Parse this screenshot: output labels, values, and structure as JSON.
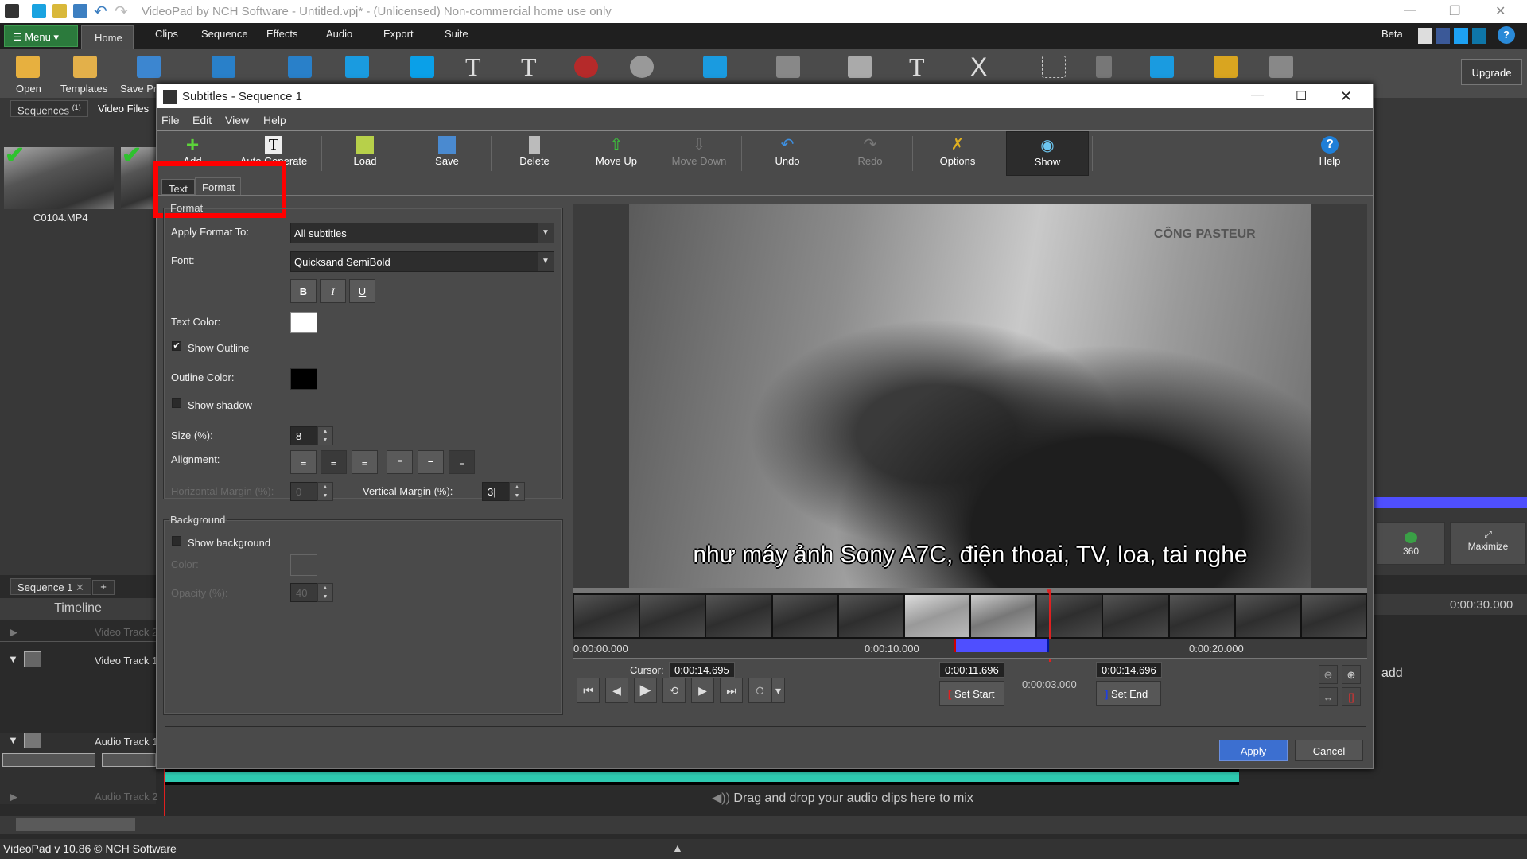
{
  "app": {
    "title": "VideoPad by NCH Software - Untitled.vpj* - (Unlicensed) Non-commercial home use only",
    "menu_label": "Menu",
    "tabs": [
      "Home",
      "Clips",
      "Sequence",
      "Effects",
      "Audio",
      "Export",
      "Suite"
    ],
    "beta": "Beta",
    "upgrade": "Upgrade",
    "ribbon": [
      "Open",
      "Templates",
      "Save Pr"
    ],
    "bin_tabs": {
      "sequences": "Sequences",
      "sequences_count": "(1)",
      "video_files": "Video Files"
    },
    "clip_name": "C0104.MP4",
    "timeline": {
      "seq_tab": "Sequence 1",
      "add_tab": "+",
      "header": "Timeline",
      "tracks": [
        "Video Track 2",
        "Video Track 1",
        "Audio Track 1",
        "Audio Track 2"
      ],
      "ruler_end": "0:00:30.000",
      "hint_add": "add",
      "audio_hint": "Drag and drop your audio clips here to mix"
    },
    "preview_buttons": {
      "vr": "360",
      "maximize": "Maximize"
    },
    "status": "VideoPad v 10.86 © NCH Software"
  },
  "dialog": {
    "title": "Subtitles - Sequence 1",
    "menu": [
      "File",
      "Edit",
      "View",
      "Help"
    ],
    "toolbar": [
      {
        "label": "Add",
        "icon": "plus-icon",
        "disabled": false
      },
      {
        "label": "Auto Generate",
        "icon": "auto-generate-icon",
        "disabled": false
      },
      {
        "label": "Load",
        "icon": "folder-icon",
        "disabled": false
      },
      {
        "label": "Save",
        "icon": "save-icon",
        "disabled": false
      },
      {
        "label": "Delete",
        "icon": "trash-icon",
        "disabled": false
      },
      {
        "label": "Move Up",
        "icon": "move-up-icon",
        "disabled": false
      },
      {
        "label": "Move Down",
        "icon": "move-down-icon",
        "disabled": true
      },
      {
        "label": "Undo",
        "icon": "undo-icon",
        "disabled": false
      },
      {
        "label": "Redo",
        "icon": "redo-icon",
        "disabled": true
      },
      {
        "label": "Options",
        "icon": "tools-icon",
        "disabled": false
      },
      {
        "label": "Show",
        "icon": "eye-icon",
        "disabled": false,
        "active": true
      },
      {
        "label": "Help",
        "icon": "help-icon",
        "disabled": false
      }
    ],
    "tabs": {
      "text": "Text",
      "format": "Format",
      "active": "Format"
    },
    "format": {
      "legend": "Format",
      "apply_to_label": "Apply Format To:",
      "apply_to_value": "All subtitles",
      "font_label": "Font:",
      "font_value": "Quicksand SemiBold",
      "bold": "B",
      "italic": "I",
      "underline": "U",
      "text_color_label": "Text Color:",
      "text_color": "#ffffff",
      "show_outline": "Show Outline",
      "show_outline_checked": true,
      "outline_color_label": "Outline Color:",
      "outline_color": "#000000",
      "show_shadow": "Show shadow",
      "show_shadow_checked": false,
      "size_label": "Size (%):",
      "size_value": "8",
      "alignment_label": "Alignment:",
      "hmargin_label": "Horizontal Margin (%):",
      "hmargin_value": "0",
      "vmargin_label": "Vertical Margin (%):",
      "vmargin_value": "3"
    },
    "background": {
      "legend": "Background",
      "show_background": "Show background",
      "show_background_checked": false,
      "color_label": "Color:",
      "opacity_label": "Opacity (%):",
      "opacity_value": "40"
    },
    "preview": {
      "subtitle": "như máy ảnh Sony A7C, điện thoại, TV, loa, tai nghe",
      "sign": "CÔNG PASTEUR",
      "ruler": [
        "0:00:00.000",
        "0:00:10.000",
        "0:00:20.000"
      ],
      "cursor_label": "Cursor:",
      "cursor": "0:00:14.695",
      "start": "0:00:11.696",
      "end": "0:00:14.696",
      "duration": "0:00:03.000",
      "set_start": "Set Start",
      "set_end": "Set End"
    },
    "apply": "Apply",
    "cancel": "Cancel"
  },
  "colors": {
    "accent": "#3c6fd0",
    "highlight": "#ff0000",
    "selection": "#4f4fff",
    "menu_green": "#2b7a3c"
  }
}
